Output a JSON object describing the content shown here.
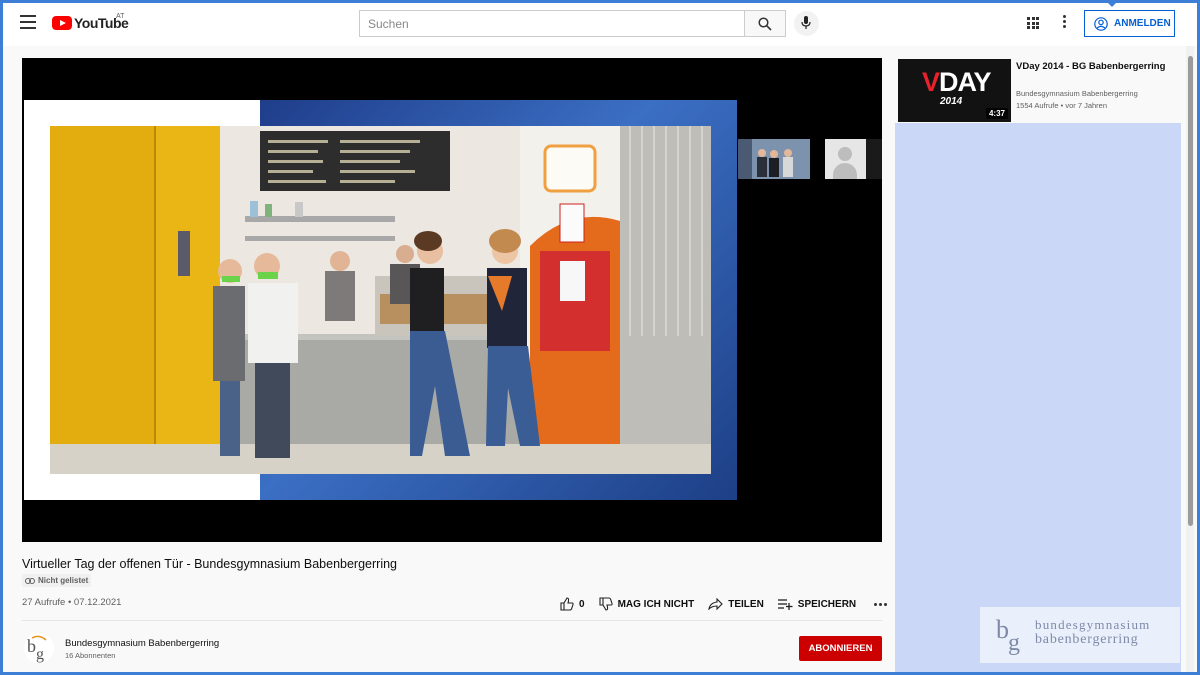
{
  "header": {
    "logo_text": "YouTube",
    "region": "AT",
    "search_placeholder": "Suchen",
    "signin_label": "ANMELDEN"
  },
  "video": {
    "title": "Virtueller Tag der offenen Tür - Bundesgymnasium Babenbergerring",
    "visibility": "Nicht gelistet",
    "views_date": "27 Aufrufe • 07.12.2021",
    "likes": "0",
    "dislike_label": "MAG ICH NICHT",
    "share_label": "TEILEN",
    "save_label": "SPEICHERN"
  },
  "channel": {
    "name": "Bundesgymnasium Babenbergerring",
    "subscribers": "16 Abonnenten",
    "subscribe_label": "ABONNIEREN"
  },
  "recommended": [
    {
      "thumb_text_v": "V",
      "thumb_text_day": "DAY",
      "thumb_text_year": "2014",
      "duration": "4:37",
      "title": "VDay 2014 - BG Babenbergerring",
      "channel": "Bundesgymnasium Babenbergerring",
      "meta": "1554 Aufrufe • vor 7 Jahren"
    }
  ],
  "watermark": {
    "line1": "bundesgymnasium",
    "line2": "babenbergerring"
  },
  "colors": {
    "brand_red": "#ff0000",
    "subscribe_red": "#cc0000",
    "signin_blue": "#065fd4",
    "side_panel": "#cad7f6",
    "frame_blue": "#3d7fd6"
  }
}
